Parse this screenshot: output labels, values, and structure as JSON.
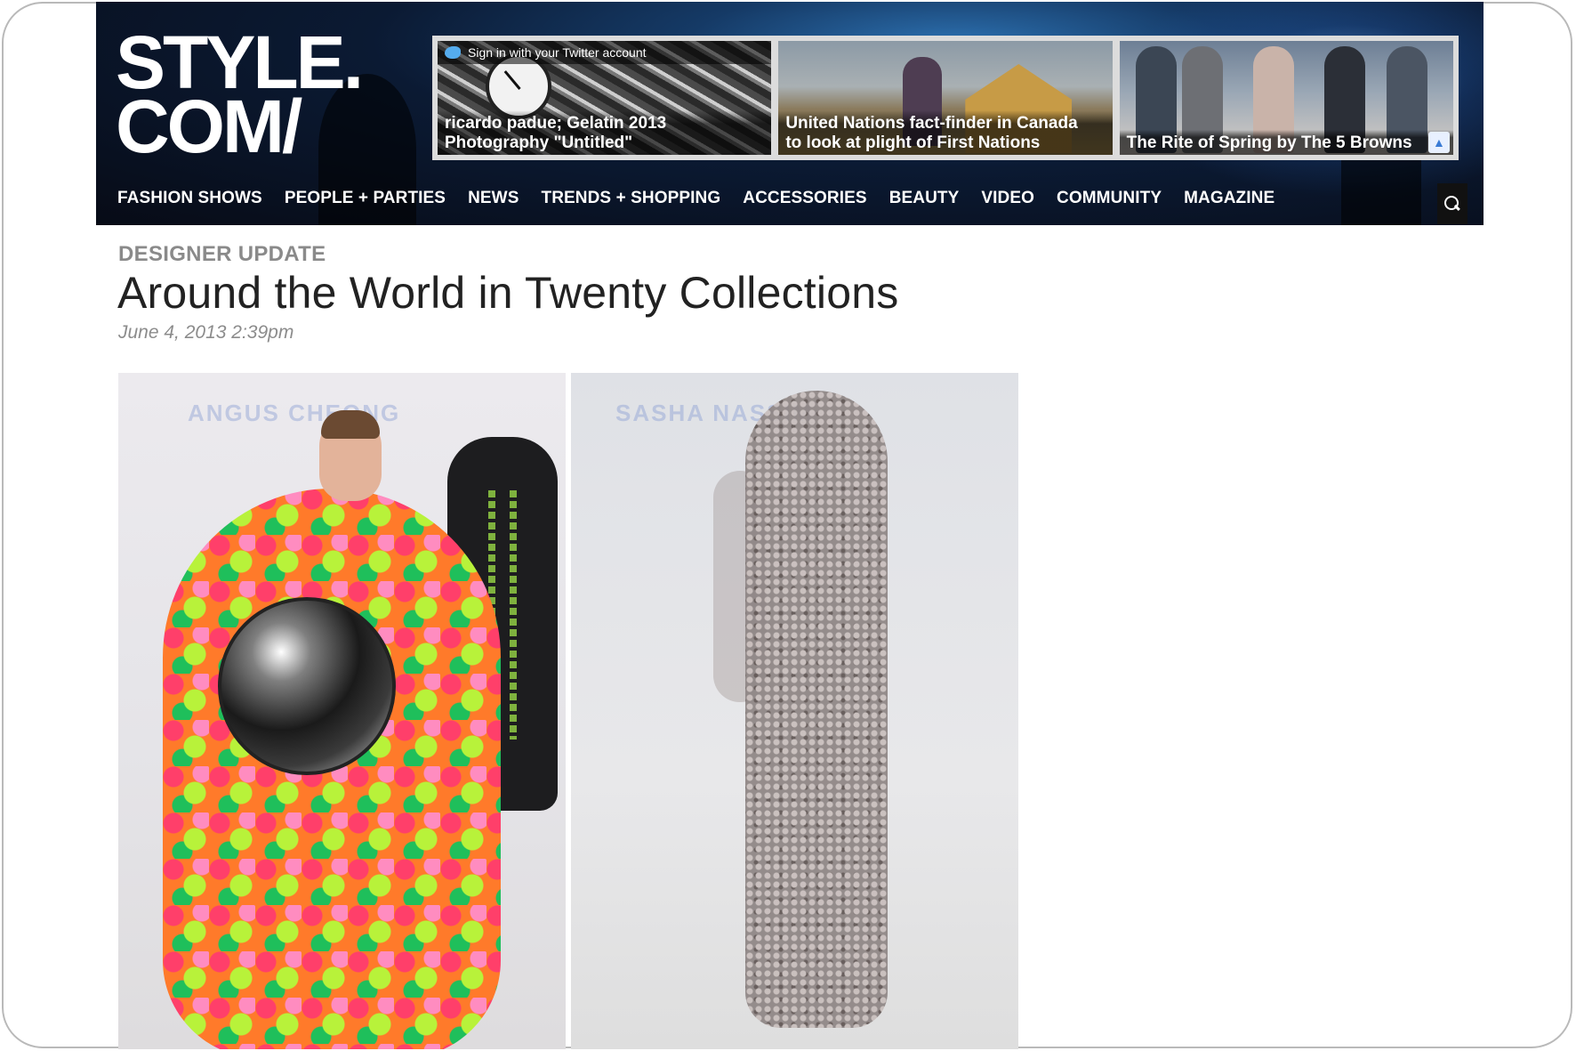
{
  "site": {
    "logo_line1": "STYLE.",
    "logo_line2": "COM/"
  },
  "promos": [
    {
      "top_bar": "Sign in with your Twitter account",
      "caption_line1": "ricardo padue; Gelatin 2013",
      "caption_line2": "Photography \"Untitled\"",
      "icon": "twitter-icon"
    },
    {
      "caption_line1": "United Nations fact-finder in Canada",
      "caption_line2": "to look at plight of First Nations"
    },
    {
      "caption_line1": "The Rite of Spring by The 5 Browns",
      "icon": "up-arrow-icon"
    }
  ],
  "nav": {
    "items": [
      "FASHION SHOWS",
      "PEOPLE + PARTIES",
      "NEWS",
      "TRENDS + SHOPPING",
      "ACCESSORIES",
      "BEAUTY",
      "VIDEO",
      "COMMUNITY",
      "MAGAZINE"
    ],
    "search_icon": "search-icon"
  },
  "article": {
    "section": "DESIGNER UPDATE",
    "title": "Around the World in Twenty Collections",
    "date": "June 4, 2013 2:39pm"
  },
  "colors": {
    "header_bg": "#0b1a33",
    "nav_text": "#ffffff",
    "section_label": "#8a8a8a",
    "title_text": "#222222",
    "date_text": "#8c8c8c",
    "twitter_blue": "#55acee"
  }
}
